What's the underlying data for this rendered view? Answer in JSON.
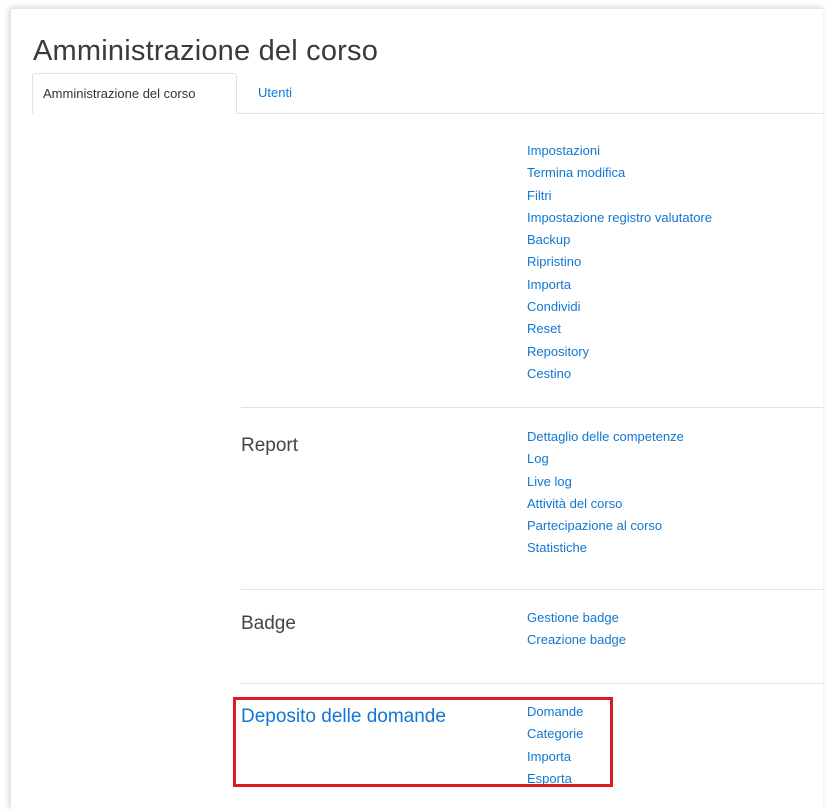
{
  "page": {
    "title": "Amministrazione del corso"
  },
  "tabs": [
    {
      "label": "Amministrazione del corso",
      "active": true
    },
    {
      "label": "Utenti",
      "active": false
    }
  ],
  "sections": {
    "course": {
      "title": "",
      "links": [
        "Impostazioni",
        "Termina modifica",
        "Filtri",
        "Impostazione registro valutatore",
        "Backup",
        "Ripristino",
        "Importa",
        "Condividi",
        "Reset",
        "Repository",
        "Cestino"
      ]
    },
    "report": {
      "title": "Report",
      "links": [
        "Dettaglio delle competenze",
        "Log",
        "Live log",
        "Attività del corso",
        "Partecipazione al corso",
        "Statistiche"
      ]
    },
    "badge": {
      "title": "Badge",
      "links": [
        "Gestione badge",
        "Creazione badge"
      ]
    },
    "question_bank": {
      "title": "Deposito delle domande",
      "links": [
        "Domande",
        "Categorie",
        "Importa",
        "Esporta"
      ]
    }
  },
  "colors": {
    "link": "#1177d1",
    "highlight": "#e0191f",
    "title": "#3a3a3a",
    "border": "#dee2e6"
  }
}
